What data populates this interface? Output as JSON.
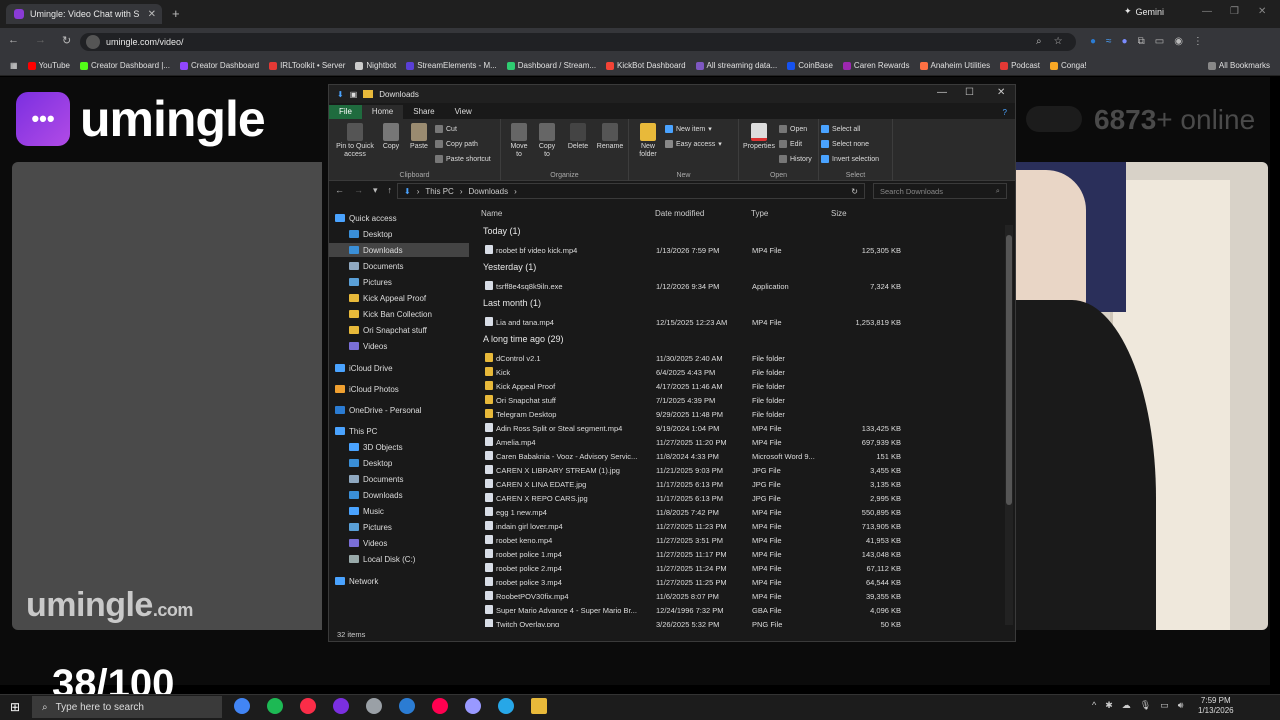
{
  "browser": {
    "tab_title": "Umingle: Video Chat with S",
    "new_tab": "+",
    "gemini": "Gemini",
    "url": "umingle.com/video/",
    "all_bookmarks": "All Bookmarks",
    "bookmarks": [
      {
        "label": "YouTube",
        "color": "#ff0000"
      },
      {
        "label": "Creator Dashboard |...",
        "color": "#53fc18"
      },
      {
        "label": "Creator Dashboard",
        "color": "#9146ff"
      },
      {
        "label": "IRLToolkit • Server",
        "color": "#e53935"
      },
      {
        "label": "Nightbot",
        "color": "#cccccc"
      },
      {
        "label": "StreamElements - M...",
        "color": "#5a3fd6"
      },
      {
        "label": "Dashboard / Stream...",
        "color": "#2ecc71"
      },
      {
        "label": "KickBot Dashboard",
        "color": "#f44336"
      },
      {
        "label": "All streaming data...",
        "color": "#7e57c2"
      },
      {
        "label": "CoinBase",
        "color": "#1652f0"
      },
      {
        "label": "Caren Rewards",
        "color": "#9c27b0"
      },
      {
        "label": "Anaheim Utilities",
        "color": "#ff7043"
      },
      {
        "label": "Podcast",
        "color": "#e53935"
      },
      {
        "label": "Conga!",
        "color": "#f9a825"
      }
    ]
  },
  "site": {
    "logo_text": "umingle",
    "watermark_main": "umingle",
    "watermark_tld": ".com",
    "online_count": "6873",
    "online_suffix": "+ online",
    "counter": "38/100"
  },
  "explorer": {
    "title": "Downloads",
    "ribbon_tabs": [
      "File",
      "Home",
      "Share",
      "View"
    ],
    "groups": {
      "clipboard": "Clipboard",
      "organize": "Organize",
      "new": "New",
      "open": "Open",
      "select": "Select"
    },
    "buttons": {
      "pin": "Pin to Quick access",
      "copy": "Copy",
      "paste": "Paste",
      "cut": "Cut",
      "copy_path": "Copy path",
      "paste_shortcut": "Paste shortcut",
      "move_to": "Move to",
      "copy_to": "Copy to",
      "delete": "Delete",
      "rename": "Rename",
      "new_folder": "New folder",
      "new_item": "New item",
      "easy_access": "Easy access",
      "properties": "Properties",
      "open": "Open",
      "edit": "Edit",
      "history": "History",
      "select_all": "Select all",
      "select_none": "Select none",
      "invert_selection": "Invert selection"
    },
    "path": [
      "This PC",
      "Downloads"
    ],
    "search_placeholder": "Search Downloads",
    "nav": [
      {
        "label": "Quick access",
        "indent": 0,
        "color": "#4aa3ff"
      },
      {
        "label": "Desktop",
        "indent": 1,
        "color": "#3a8fd8"
      },
      {
        "label": "Downloads",
        "indent": 1,
        "color": "#3a8fd8",
        "selected": true
      },
      {
        "label": "Documents",
        "indent": 1,
        "color": "#8fa8c0"
      },
      {
        "label": "Pictures",
        "indent": 1,
        "color": "#5aa0d8"
      },
      {
        "label": "Kick Appeal Proof",
        "indent": 1,
        "color": "#e8b93a"
      },
      {
        "label": "Kick Ban Collection",
        "indent": 1,
        "color": "#e8b93a"
      },
      {
        "label": "Ori Snapchat stuff",
        "indent": 1,
        "color": "#e8b93a"
      },
      {
        "label": "Videos",
        "indent": 1,
        "color": "#7a6fd8"
      },
      {
        "label": "iCloud Drive",
        "indent": 0,
        "color": "#4aa3ff"
      },
      {
        "label": "iCloud Photos",
        "indent": 0,
        "color": "#f0a030"
      },
      {
        "label": "OneDrive - Personal",
        "indent": 0,
        "color": "#2b7cd3"
      },
      {
        "label": "This PC",
        "indent": 0,
        "color": "#4aa3ff"
      },
      {
        "label": "3D Objects",
        "indent": 1,
        "color": "#4aa3ff"
      },
      {
        "label": "Desktop",
        "indent": 1,
        "color": "#3a8fd8"
      },
      {
        "label": "Documents",
        "indent": 1,
        "color": "#8fa8c0"
      },
      {
        "label": "Downloads",
        "indent": 1,
        "color": "#3a8fd8"
      },
      {
        "label": "Music",
        "indent": 1,
        "color": "#4aa3ff"
      },
      {
        "label": "Pictures",
        "indent": 1,
        "color": "#5aa0d8"
      },
      {
        "label": "Videos",
        "indent": 1,
        "color": "#7a6fd8"
      },
      {
        "label": "Local Disk (C:)",
        "indent": 1,
        "color": "#9aa"
      },
      {
        "label": "Network",
        "indent": 0,
        "color": "#4aa3ff"
      }
    ],
    "columns": [
      "Name",
      "Date modified",
      "Type",
      "Size"
    ],
    "groups_list": [
      {
        "title": "Today (1)",
        "files": [
          {
            "name": "roobet bf video kick.mp4",
            "date": "1/13/2026 7:59 PM",
            "type": "MP4 File",
            "size": "125,305 KB",
            "kind": "file"
          }
        ]
      },
      {
        "title": "Yesterday (1)",
        "files": [
          {
            "name": "tsrff8e4sq8k9iln.exe",
            "date": "1/12/2026 9:34 PM",
            "type": "Application",
            "size": "7,324 KB",
            "kind": "file"
          }
        ]
      },
      {
        "title": "Last month (1)",
        "files": [
          {
            "name": "Lia and tana.mp4",
            "date": "12/15/2025 12:23 AM",
            "type": "MP4 File",
            "size": "1,253,819 KB",
            "kind": "file"
          }
        ]
      },
      {
        "title": "A long time ago (29)",
        "files": [
          {
            "name": "dControl v2.1",
            "date": "11/30/2025 2:40 AM",
            "type": "File folder",
            "size": "",
            "kind": "folder"
          },
          {
            "name": "Kick",
            "date": "6/4/2025 4:43 PM",
            "type": "File folder",
            "size": "",
            "kind": "folder"
          },
          {
            "name": "Kick Appeal Proof",
            "date": "4/17/2025 11:46 AM",
            "type": "File folder",
            "size": "",
            "kind": "folder"
          },
          {
            "name": "Ori Snapchat stuff",
            "date": "7/1/2025 4:39 PM",
            "type": "File folder",
            "size": "",
            "kind": "folder"
          },
          {
            "name": "Telegram Desktop",
            "date": "9/29/2025 11:48 PM",
            "type": "File folder",
            "size": "",
            "kind": "folder"
          },
          {
            "name": "Adin Ross Split or Steal segment.mp4",
            "date": "9/19/2024 1:04 PM",
            "type": "MP4 File",
            "size": "133,425 KB",
            "kind": "file"
          },
          {
            "name": "Amelia.mp4",
            "date": "11/27/2025 11:20 PM",
            "type": "MP4 File",
            "size": "697,939 KB",
            "kind": "file"
          },
          {
            "name": "Caren Babaknia - Vooz - Advisory Servic...",
            "date": "11/8/2024 4:33 PM",
            "type": "Microsoft Word 9...",
            "size": "151 KB",
            "kind": "file"
          },
          {
            "name": "CAREN X LIBRARY STREAM (1).jpg",
            "date": "11/21/2025 9:03 PM",
            "type": "JPG File",
            "size": "3,455 KB",
            "kind": "file"
          },
          {
            "name": "CAREN X LINA EDATE.jpg",
            "date": "11/17/2025 6:13 PM",
            "type": "JPG File",
            "size": "3,135 KB",
            "kind": "file"
          },
          {
            "name": "CAREN X REPO CARS.jpg",
            "date": "11/17/2025 6:13 PM",
            "type": "JPG File",
            "size": "2,995 KB",
            "kind": "file"
          },
          {
            "name": "egg 1 new.mp4",
            "date": "11/8/2025 7:42 PM",
            "type": "MP4 File",
            "size": "550,895 KB",
            "kind": "file"
          },
          {
            "name": "indain girl lover.mp4",
            "date": "11/27/2025 11:23 PM",
            "type": "MP4 File",
            "size": "713,905 KB",
            "kind": "file"
          },
          {
            "name": "roobet keno.mp4",
            "date": "11/27/2025 3:51 PM",
            "type": "MP4 File",
            "size": "41,953 KB",
            "kind": "file"
          },
          {
            "name": "roobet police 1.mp4",
            "date": "11/27/2025 11:17 PM",
            "type": "MP4 File",
            "size": "143,048 KB",
            "kind": "file"
          },
          {
            "name": "roobet police 2.mp4",
            "date": "11/27/2025 11:24 PM",
            "type": "MP4 File",
            "size": "67,112 KB",
            "kind": "file"
          },
          {
            "name": "roobet police 3.mp4",
            "date": "11/27/2025 11:25 PM",
            "type": "MP4 File",
            "size": "64,544 KB",
            "kind": "file"
          },
          {
            "name": "RoobetPOV30fix.mp4",
            "date": "11/6/2025 8:07 PM",
            "type": "MP4 File",
            "size": "39,355 KB",
            "kind": "file"
          },
          {
            "name": "Super Mario Advance 4 - Super Mario Br...",
            "date": "12/24/1996 7:32 PM",
            "type": "GBA File",
            "size": "4,096 KB",
            "kind": "file"
          },
          {
            "name": "Twitch Overlay.png",
            "date": "3/26/2025 5:32 PM",
            "type": "PNG File",
            "size": "50 KB",
            "kind": "file"
          }
        ]
      }
    ],
    "status": "32 items"
  },
  "taskbar": {
    "search_placeholder": "Type here to search",
    "time": "7:59 PM",
    "date": "1/13/2026",
    "apps": [
      "#4285f4",
      "#1db954",
      "#fa2d48",
      "#7b2fe0",
      "#9aa0a6",
      "#2b7cd3",
      "#ff0050",
      "#9999ff",
      "#27a7e7",
      "#e8b93a"
    ]
  }
}
